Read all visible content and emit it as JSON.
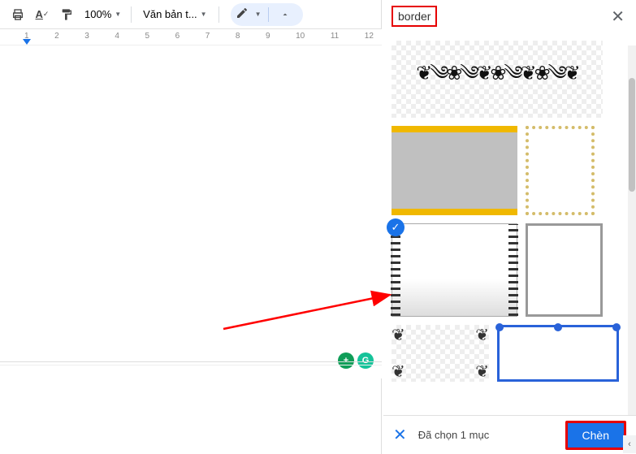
{
  "toolbar": {
    "zoom": "100%",
    "style": "Văn bản t..."
  },
  "ruler": {
    "nums": [
      "1",
      "2",
      "3",
      "4",
      "5",
      "6",
      "7",
      "8",
      "9",
      "10",
      "11",
      "12"
    ]
  },
  "panel": {
    "search": "border"
  },
  "footer": {
    "selected": "Đã chọn 1 mục",
    "insert": "Chèn"
  }
}
